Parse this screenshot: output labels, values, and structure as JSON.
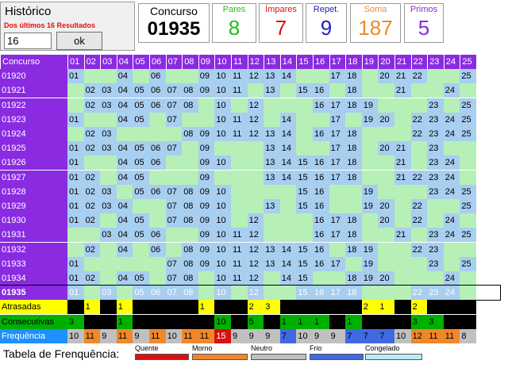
{
  "historico": {
    "title": "Histórico",
    "subtitle": "Dos últimos 16 Resultados",
    "input_value": "16",
    "ok_label": "ok"
  },
  "stats": {
    "concurso_label": "Concurso",
    "concurso_value": "01935",
    "pares_label": "Pares",
    "pares_value": "8",
    "impares_label": "Ímpares",
    "impares_value": "7",
    "repet_label": "Repet.",
    "repet_value": "9",
    "soma_label": "Soma",
    "soma_value": "187",
    "primos_label": "Primos",
    "primos_value": "5"
  },
  "colors": {
    "pares": "#1fbf1f",
    "impares": "#e01010",
    "repet": "#2020c0",
    "soma": "#f0882a",
    "primos": "#8a2be2",
    "header": "#8a2be2",
    "drawn": "#a8cef0",
    "not_drawn": "#b6f0b6"
  },
  "table": {
    "header_label": "Concurso",
    "numbers": [
      "01",
      "02",
      "03",
      "04",
      "05",
      "06",
      "07",
      "08",
      "09",
      "10",
      "11",
      "12",
      "13",
      "14",
      "15",
      "16",
      "17",
      "18",
      "19",
      "20",
      "21",
      "22",
      "23",
      "24",
      "25"
    ],
    "rows": [
      {
        "concurso": "01920",
        "drawn": [
          1,
          4,
          6,
          9,
          10,
          11,
          12,
          13,
          14,
          17,
          18,
          20,
          21,
          22,
          25
        ]
      },
      {
        "concurso": "01921",
        "drawn": [
          2,
          3,
          4,
          5,
          6,
          7,
          8,
          9,
          10,
          11,
          13,
          15,
          16,
          18,
          21,
          24
        ]
      },
      {
        "concurso": "01922",
        "drawn": [
          2,
          3,
          4,
          5,
          6,
          7,
          8,
          10,
          12,
          16,
          17,
          18,
          19,
          23,
          25
        ]
      },
      {
        "concurso": "01923",
        "drawn": [
          1,
          4,
          5,
          7,
          10,
          11,
          12,
          14,
          17,
          19,
          20,
          22,
          23,
          24,
          25
        ]
      },
      {
        "concurso": "01924",
        "drawn": [
          2,
          3,
          8,
          9,
          10,
          11,
          12,
          13,
          14,
          16,
          17,
          18,
          22,
          23,
          24,
          25
        ]
      },
      {
        "concurso": "01925",
        "drawn": [
          1,
          2,
          3,
          4,
          5,
          6,
          7,
          9,
          13,
          14,
          17,
          18,
          20,
          21,
          23
        ]
      },
      {
        "concurso": "01926",
        "drawn": [
          1,
          4,
          5,
          6,
          9,
          10,
          13,
          14,
          15,
          16,
          17,
          18,
          21,
          23,
          24
        ]
      },
      {
        "concurso": "01927",
        "drawn": [
          1,
          2,
          4,
          5,
          9,
          13,
          14,
          15,
          16,
          17,
          18,
          21,
          22,
          23,
          24
        ]
      },
      {
        "concurso": "01928",
        "drawn": [
          1,
          2,
          3,
          5,
          6,
          7,
          8,
          9,
          10,
          15,
          16,
          19,
          23,
          24,
          25
        ]
      },
      {
        "concurso": "01929",
        "drawn": [
          1,
          2,
          3,
          4,
          7,
          8,
          9,
          10,
          13,
          15,
          16,
          19,
          20,
          22,
          25
        ]
      },
      {
        "concurso": "01930",
        "drawn": [
          1,
          2,
          4,
          5,
          7,
          8,
          9,
          10,
          12,
          16,
          17,
          18,
          20,
          22,
          24
        ]
      },
      {
        "concurso": "01931",
        "drawn": [
          3,
          4,
          5,
          6,
          9,
          10,
          11,
          12,
          16,
          17,
          18,
          21,
          23,
          24,
          25
        ]
      },
      {
        "concurso": "01932",
        "drawn": [
          2,
          4,
          6,
          8,
          9,
          10,
          11,
          12,
          13,
          14,
          15,
          16,
          18,
          19,
          22,
          23
        ]
      },
      {
        "concurso": "01933",
        "drawn": [
          1,
          7,
          8,
          9,
          10,
          11,
          12,
          13,
          14,
          15,
          16,
          17,
          19,
          23,
          25
        ]
      },
      {
        "concurso": "01934",
        "drawn": [
          1,
          2,
          4,
          5,
          7,
          8,
          10,
          11,
          12,
          14,
          15,
          18,
          19,
          20,
          24
        ]
      },
      {
        "concurso": "01935",
        "drawn": [
          1,
          3,
          5,
          6,
          7,
          8,
          10,
          12,
          15,
          16,
          17,
          18,
          22,
          23,
          24
        ]
      }
    ],
    "atrasadas_label": "Atrasadas",
    "atrasadas": [
      "",
      "1",
      "",
      "1",
      "",
      "",
      "",
      "",
      "1",
      "",
      "",
      "2",
      "3",
      "",
      "",
      "",
      "",
      "",
      "2",
      "1",
      "",
      "2",
      "",
      "",
      ""
    ],
    "consecutivas_label": "Consecutivas",
    "consecutivas": [
      "3",
      "",
      "",
      "1",
      "",
      "",
      "",
      "",
      "",
      "10",
      "",
      "5",
      "",
      "1",
      "1",
      "1",
      "",
      "1",
      "",
      "",
      "",
      "3",
      "3",
      "",
      ""
    ],
    "frequencia_label": "Frequência",
    "frequencia": [
      "10",
      "11",
      "9",
      "11",
      "9",
      "11",
      "10",
      "11",
      "11",
      "15",
      "9",
      "9",
      "9",
      "7",
      "10",
      "9",
      "9",
      "7",
      "7",
      "7",
      "10",
      "12",
      "11",
      "11",
      "8"
    ]
  },
  "legend": {
    "title": "Tabela de Frenquência:",
    "items": [
      {
        "label": "Quente",
        "color": "#d81010"
      },
      {
        "label": "Morno",
        "color": "#f0882a"
      },
      {
        "label": "Neutro",
        "color": "#c0c0c0"
      },
      {
        "label": "Frio",
        "color": "#4169e1"
      },
      {
        "label": "Congelado",
        "color": "#b8ecf8"
      }
    ]
  }
}
